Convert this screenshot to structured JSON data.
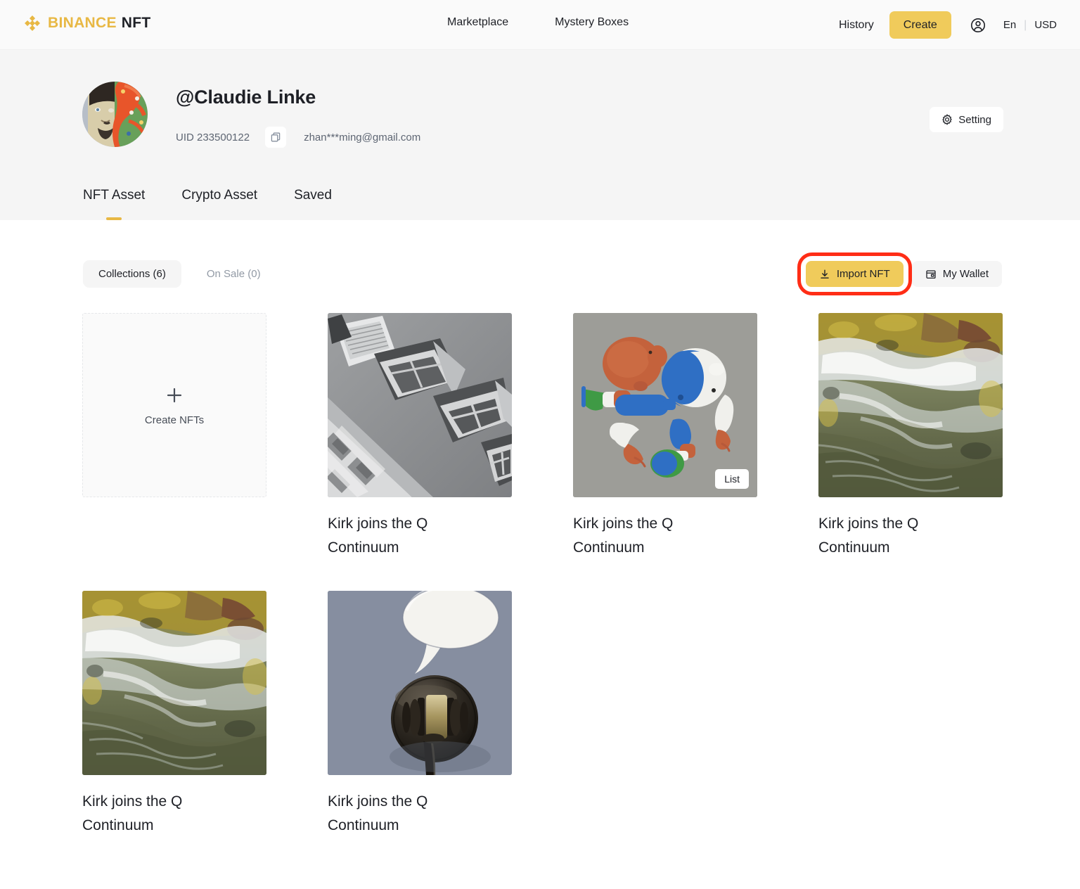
{
  "header": {
    "logo": {
      "brand": "BINANCE",
      "suffix": "NFT",
      "icon": "binance-diamond-icon"
    },
    "nav": [
      {
        "label": "Marketplace",
        "name": "nav-marketplace"
      },
      {
        "label": "Mystery Boxes",
        "name": "nav-mystery-boxes"
      }
    ],
    "history_label": "History",
    "create_label": "Create",
    "account_icon": "user-circle-icon",
    "language": "En",
    "currency": "USD",
    "accent_yellow": "#F0CB5B"
  },
  "profile": {
    "avatar_icon": "user-avatar",
    "username": "@Claudie Linke",
    "uid": "UID 233500122",
    "copy_icon": "copy-icon",
    "email": "zhan***ming@gmail.com",
    "setting_label": "Setting",
    "setting_icon": "gear-icon",
    "tabs": [
      {
        "label": "NFT Asset",
        "active": true
      },
      {
        "label": "Crypto Asset",
        "active": false
      },
      {
        "label": "Saved",
        "active": false
      }
    ]
  },
  "content": {
    "filters": [
      {
        "label": "Collections (6)",
        "active": true
      },
      {
        "label": "On Sale (0)",
        "active": false
      }
    ],
    "import_label": "Import NFT",
    "import_icon": "download-icon",
    "wallet_label": "My Wallet",
    "wallet_icon": "wallet-icon",
    "highlight_color": "#FF2D16",
    "create_card": {
      "label": "Create NFTs",
      "icon": "plus-icon"
    },
    "nfts": [
      {
        "title": "Kirk joins the Q Continuum",
        "art": "architecture-bw",
        "badge": null
      },
      {
        "title": "Kirk joins the Q Continuum",
        "art": "toy-parts-3d",
        "badge": "List"
      },
      {
        "title": "Kirk joins the Q Continuum",
        "art": "river-water",
        "badge": null
      },
      {
        "title": "Kirk joins the Q Continuum",
        "art": "river-water",
        "badge": null
      },
      {
        "title": "Kirk joins the Q Continuum",
        "art": "gavel-speech-bubble",
        "badge": null
      }
    ]
  }
}
